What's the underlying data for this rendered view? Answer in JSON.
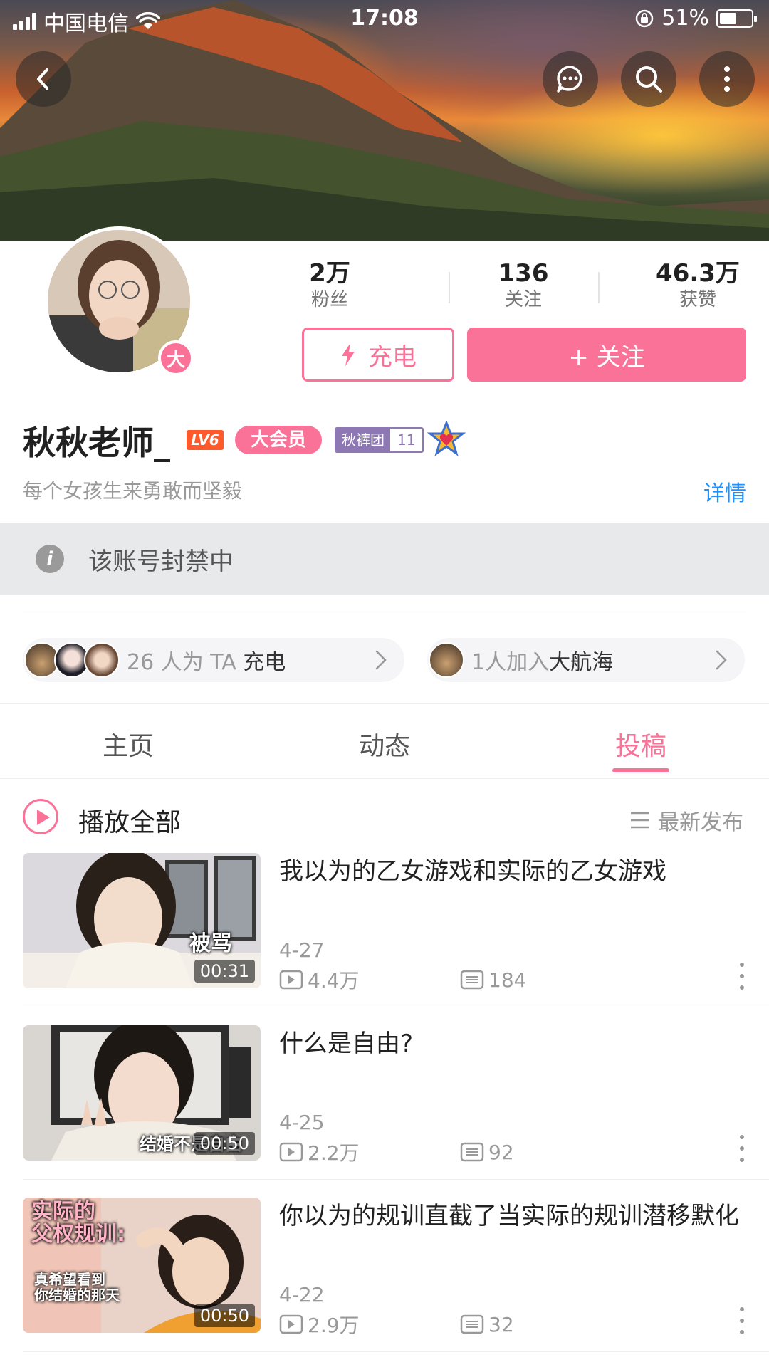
{
  "status_bar": {
    "carrier": "中国电信",
    "time": "17:08",
    "battery": "51%"
  },
  "profile": {
    "stats": [
      {
        "value": "2万",
        "label": "粉丝"
      },
      {
        "value": "136",
        "label": "关注"
      },
      {
        "value": "46.3万",
        "label": "获赞"
      }
    ],
    "charge_button": "充电",
    "follow_button": "+ 关注",
    "vip_dot": "大",
    "name": "秋秋老师_",
    "level": "LV6",
    "vip_label": "大会员",
    "fan_badge_name": "秋裤团",
    "fan_badge_level": "11",
    "bio": "每个女孩生来勇敢而坚毅",
    "detail_link": "详情"
  },
  "banned_notice": "该账号封禁中",
  "charge_pill": {
    "prefix": "26 人为 TA ",
    "strong": "充电"
  },
  "voyage_pill": {
    "prefix": "1人加入",
    "strong": "大航海"
  },
  "tabs": [
    "主页",
    "动态",
    "投稿"
  ],
  "active_tab": "投稿",
  "play_all": "播放全部",
  "sort_label": "最新发布",
  "videos": [
    {
      "title": "我以为的乙女游戏和实际的乙女游戏",
      "date": "4-27",
      "views": "4.4万",
      "comments": "184",
      "duration": "00:31",
      "caption": "被骂"
    },
    {
      "title": "什么是自由?",
      "date": "4-25",
      "views": "2.2万",
      "comments": "92",
      "duration": "00:50",
      "caption": "结婚不是自由"
    },
    {
      "title": "你以为的规训直截了当实际的规训潜移默化",
      "date": "4-22",
      "views": "2.9万",
      "comments": "32",
      "duration": "00:50",
      "caption": "实际的\n父权规训:",
      "caption2": "真希望看到\n你结婚的那天"
    }
  ]
}
